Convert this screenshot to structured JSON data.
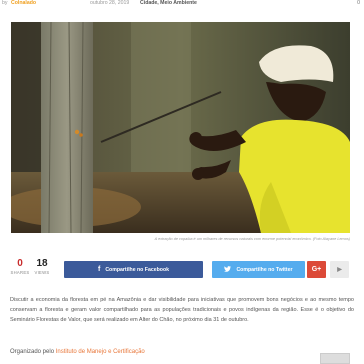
{
  "meta": {
    "by": "by",
    "author": "Colnalado",
    "date": "outubro 28, 2019",
    "categories": "Cidade, Meio Ambiente",
    "comments": "0"
  },
  "hero": {
    "image_name": "man-in-yellow-shirt-with-copaiba-tree",
    "caption": "A extração de copaíba é um milhares de recursos naturais com enorme potencial econômico. (Foto Alayane Lemos)"
  },
  "share": {
    "shares_count": "0",
    "shares_label": "SHARES",
    "views_count": "18",
    "views_label": "VIEWS",
    "facebook_label": "Compartilhe no Facebook",
    "twitter_label": "Compartilhe no Twitter",
    "gplus_label": "G+",
    "more_label": "▶",
    "colors": {
      "facebook": "#3b5a9a",
      "twitter": "#55acee",
      "gplus": "#dc4a38"
    }
  },
  "article": {
    "paragraph": "Discutir a economia da floresta em pé na Amazônia e dar visibilidade para iniciativas que promovem bons negócios e ao mesmo tempo conservam a floresta e geram valor compartilhado para as populações tradicionais e povos indígenas da região. Esse é o objetivo do Seminário Florestas de Valor, que será realizado em Alter do Chão, no próximo dia 31 de outubro.",
    "organized_prefix": "Organizado pelo ",
    "organized_link": "Instituto de Manejo e Certificação"
  }
}
